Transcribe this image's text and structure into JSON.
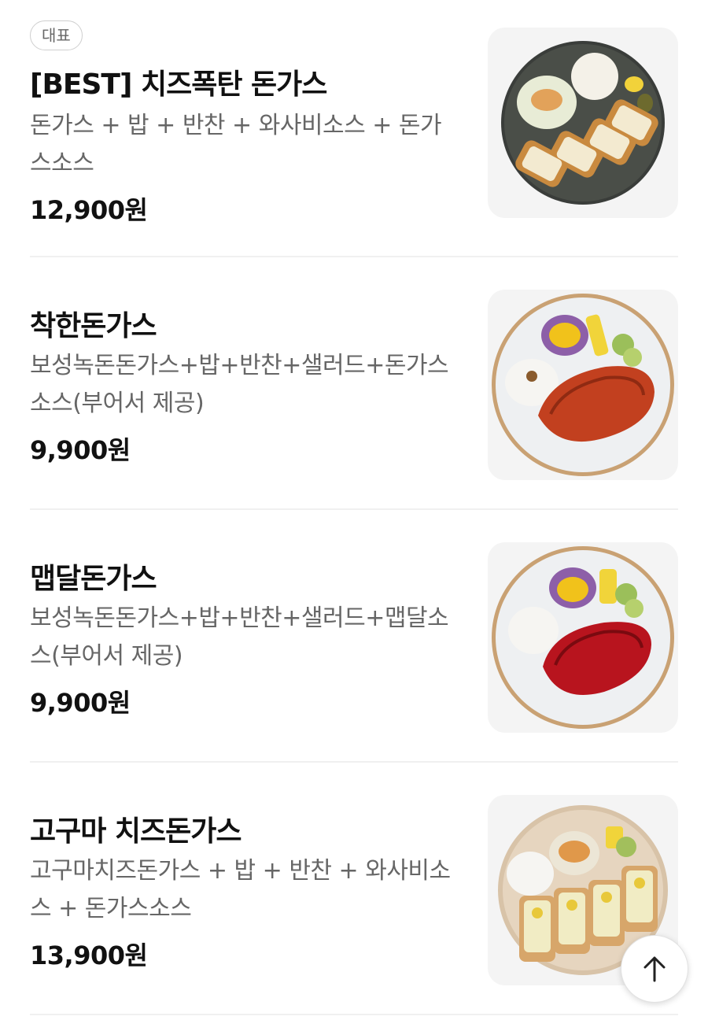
{
  "menu": {
    "items": [
      {
        "badge": "대표",
        "name": "[BEST] 치즈폭탄 돈가스",
        "description": "돈가스 + 밥 + 반찬 + 와사비소스 + 돈가스소스",
        "price": "12,900원"
      },
      {
        "name": "착한돈가스",
        "description": "보성녹돈돈가스+밥+반찬+샐러드+돈가스소스(부어서 제공)",
        "price": "9,900원"
      },
      {
        "name": "맵달돈가스",
        "description": "보성녹돈돈가스+밥+반찬+샐러드+맵달소스(부어서 제공)",
        "price": "9,900원"
      },
      {
        "name": "고구마 치즈돈가스",
        "description": "고구마치즈돈가스 + 밥 + 반찬 + 와사비소스 + 돈가스소스",
        "price": "13,900원"
      }
    ]
  },
  "scroll_top_button": {
    "icon": "arrow-up-icon"
  }
}
